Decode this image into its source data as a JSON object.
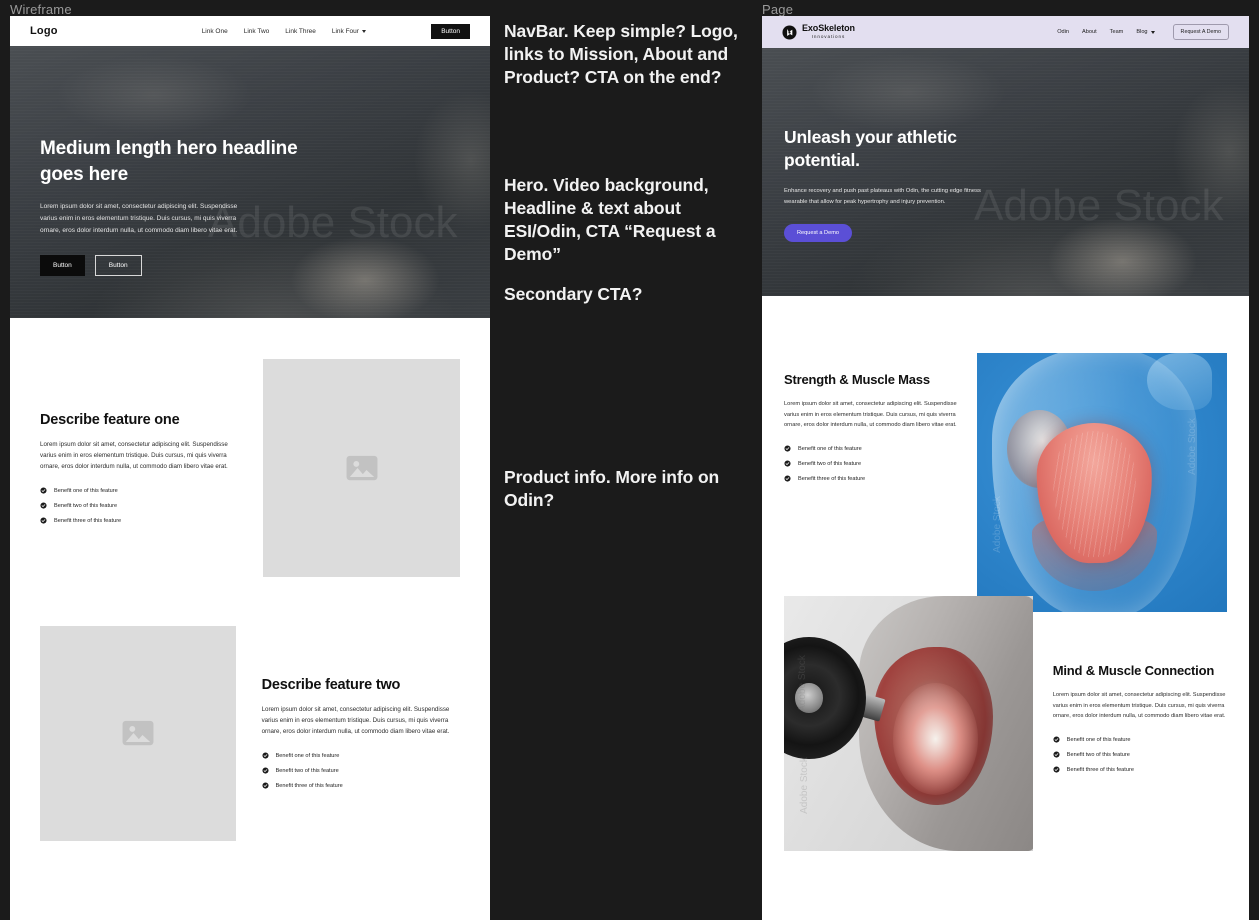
{
  "frames": {
    "wireframe_label": "Wireframe",
    "page_label": "Page"
  },
  "watermark": "Adobe Stock",
  "wireframe": {
    "navbar": {
      "logo": "Logo",
      "links": [
        "Link One",
        "Link Two",
        "Link Three",
        "Link Four"
      ],
      "dropdown_link_index": 3,
      "button": "Button"
    },
    "hero": {
      "headline": "Medium length hero headline goes here",
      "paragraph": "Lorem ipsum dolor sit amet, consectetur adipiscing elit. Suspendisse varius enim in eros elementum tristique. Duis cursus, mi quis viverra ornare, eros dolor interdum nulla, ut commodo diam libero vitae erat.",
      "primary_button": "Button",
      "secondary_button": "Button"
    },
    "feature_one": {
      "heading": "Describe feature one",
      "paragraph": "Lorem ipsum dolor sit amet, consectetur adipiscing elit. Suspendisse varius enim in eros elementum tristique. Duis cursus, mi quis viverra ornare, eros dolor interdum nulla, ut commodo diam libero vitae erat.",
      "benefits": [
        "Benefit one of this feature",
        "Benefit two of this feature",
        "Benefit three of this feature"
      ],
      "image_alt": "image-placeholder"
    },
    "feature_two": {
      "heading": "Describe feature two",
      "paragraph": "Lorem ipsum dolor sit amet, consectetur adipiscing elit. Suspendisse varius enim in eros elementum tristique. Duis cursus, mi quis viverra ornare, eros dolor interdum nulla, ut commodo diam libero vitae erat.",
      "benefits": [
        "Benefit one of this feature",
        "Benefit two of this feature",
        "Benefit three of this feature"
      ],
      "image_alt": "image-placeholder"
    }
  },
  "annotations": [
    "NavBar. Keep simple? Logo, links to Mission, About and Product? CTA on the end?",
    "Hero. Video background, Headline & text about ESI/Odin, CTA “Request a Demo”",
    "Secondary CTA?",
    "Product info. More info on Odin?"
  ],
  "page": {
    "navbar": {
      "brand_name": "ExoSkeleton",
      "brand_sub": "Innovations",
      "links": [
        "Odin",
        "About",
        "Team",
        "Blog"
      ],
      "dropdown_link_index": 3,
      "cta": "Request A Demo"
    },
    "hero": {
      "headline": "Unleash your athletic potential.",
      "paragraph": "Enhance recovery and push past plateaus with Odin, the cutting edge fitness wearable that allow for peak hypertrophy and injury prevention.",
      "button": "Request a Demo"
    },
    "feature_one": {
      "heading": "Strength & Muscle Mass",
      "paragraph": "Lorem ipsum dolor sit amet, consectetur adipiscing elit. Suspendisse varius enim in eros elementum tristique. Duis cursus, mi quis viverra ornare, eros dolor interdum nulla, ut commodo diam libero vitae erat.",
      "benefits": [
        "Benefit one of this feature",
        "Benefit two of this feature",
        "Benefit three of this feature"
      ],
      "image_alt": "anatomy-chest-muscles-illustration"
    },
    "feature_two": {
      "heading": "Mind & Muscle Connection",
      "paragraph": "Lorem ipsum dolor sit amet, consectetur adipiscing elit. Suspendisse varius enim in eros elementum tristique. Duis cursus, mi quis viverra ornare, eros dolor interdum nulla, ut commodo diam libero vitae erat.",
      "benefits": [
        "Benefit one of this feature",
        "Benefit two of this feature",
        "Benefit three of this feature"
      ],
      "image_alt": "bicep-curl-photo-highlighted-muscle"
    }
  },
  "colors": {
    "canvas_bg": "#1b1b1b",
    "wireframe_hero_bg": "#3c4044",
    "page_nav_bg": "#e3dff0",
    "page_accent": "#5b4fd6",
    "placeholder_gray": "#dcdcdc"
  }
}
